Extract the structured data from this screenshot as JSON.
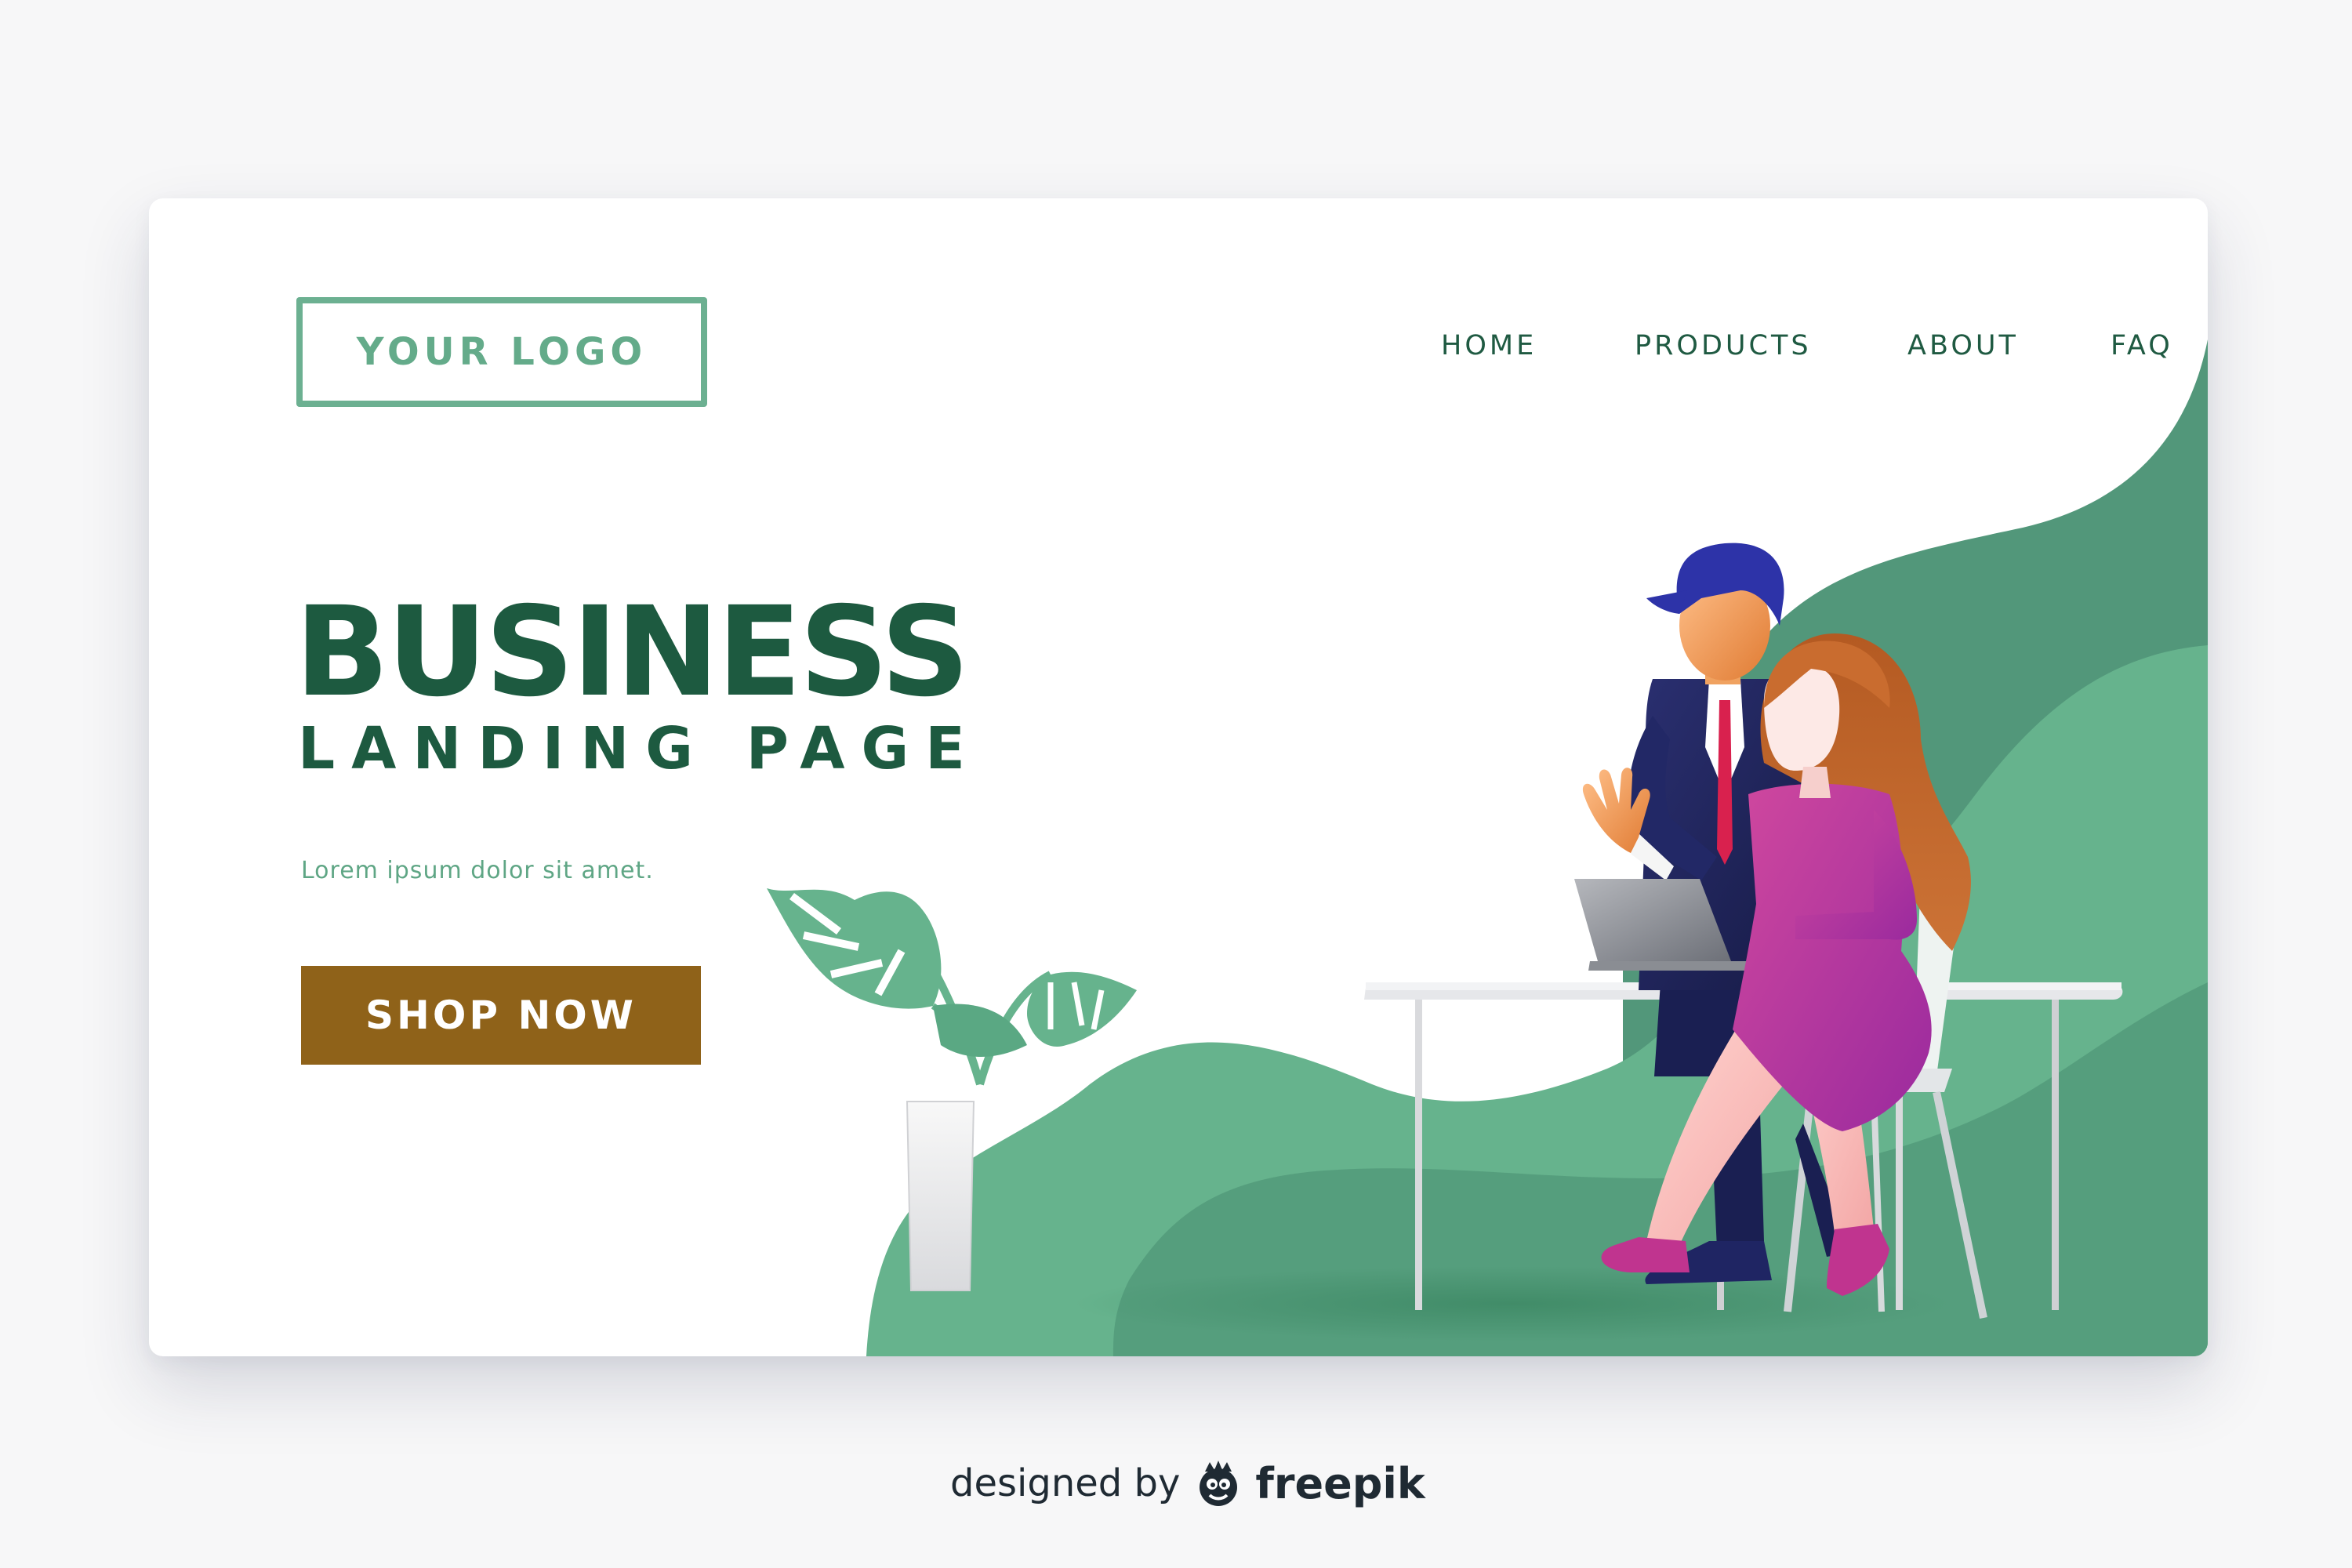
{
  "logo": {
    "text": "YOUR LOGO"
  },
  "nav": {
    "items": [
      {
        "label": "HOME"
      },
      {
        "label": "PRODUCTS"
      },
      {
        "label": "ABOUT"
      },
      {
        "label": "FAQ"
      }
    ]
  },
  "hero": {
    "title": "BUSINESS",
    "subtitle": "LANDING PAGE",
    "body": "Lorem ipsum dolor sit amet.",
    "cta_label": "SHOP NOW"
  },
  "credit": {
    "prefix": "designed by",
    "brand": "freepik"
  },
  "illustration": {
    "icons": [
      "monstera-plant-icon",
      "businessman-icon",
      "businesswoman-icon",
      "laptop-icon",
      "desk-icon",
      "chair-icon"
    ]
  },
  "colors": {
    "accent_green": "#64ab8a",
    "dark_green": "#1d5a40",
    "button_brown": "#8f6219",
    "blob_green_light": "#66b38d",
    "blob_green_dark": "#4f9676"
  }
}
